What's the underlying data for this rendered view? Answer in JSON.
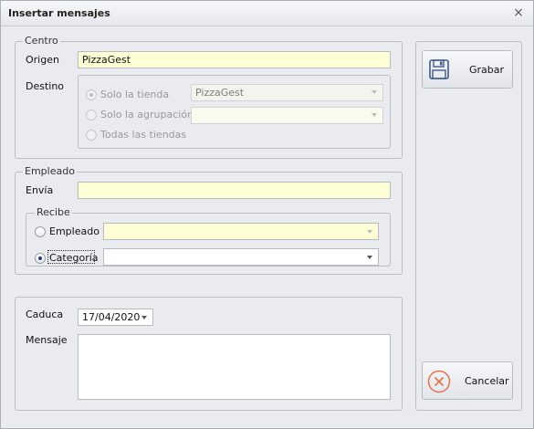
{
  "window": {
    "title": "Insertar mensajes",
    "close_glyph": "×"
  },
  "centro": {
    "group_label": "Centro",
    "origen_label": "Origen",
    "origen_value": "PizzaGest",
    "destino_label": "Destino",
    "options": [
      {
        "label": "Solo la tienda",
        "selected": true,
        "value": "PizzaGest"
      },
      {
        "label": "Solo la agrupación",
        "selected": false,
        "value": ""
      },
      {
        "label": "Todas  las  tiendas",
        "selected": false
      }
    ]
  },
  "empleado": {
    "group_label": "Empleado",
    "envia_label": "Envía",
    "envia_value": "",
    "recibe": {
      "group_label": "Recibe",
      "options": [
        {
          "label": "Empleado",
          "selected": false,
          "value": ""
        },
        {
          "label": "Categoría",
          "selected": true,
          "value": ""
        }
      ]
    }
  },
  "mensaje": {
    "caduca_label": "Caduca",
    "caduca_value": "17/04/2020",
    "mensaje_label": "Mensaje",
    "mensaje_value": ""
  },
  "actions": {
    "save_label": "Grabar",
    "save_icon": "floppy-disk-icon",
    "cancel_label": "Cancelar",
    "cancel_icon": "cancel-circle-icon",
    "cancel_color": "#e8734a",
    "save_color": "#3e5a8c"
  }
}
